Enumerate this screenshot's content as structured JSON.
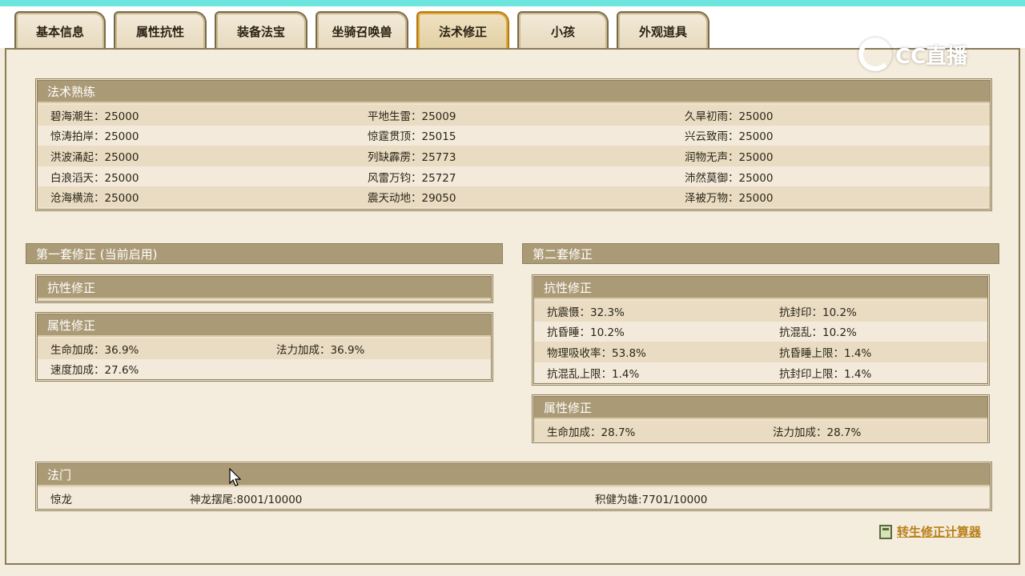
{
  "tabs": [
    {
      "label": "基本信息"
    },
    {
      "label": "属性抗性"
    },
    {
      "label": "装备法宝"
    },
    {
      "label": "坐骑召唤兽"
    },
    {
      "label": "法术修正"
    },
    {
      "label": "小孩"
    },
    {
      "label": "外观道具"
    }
  ],
  "active_tab": "法术修正",
  "watermark": "CC直播",
  "mastery": {
    "title": "法术熟练",
    "rows": [
      [
        "碧海潮生：25000",
        "平地生雷：25009",
        "久旱初雨：25000"
      ],
      [
        "惊涛拍岸：25000",
        "惊霆贯顶：25015",
        "兴云致雨：25000"
      ],
      [
        "洪波涌起：25000",
        "列缺霹雳：25773",
        "润物无声：25000"
      ],
      [
        "白浪滔天：25000",
        "风雷万钧：25727",
        "沛然莫御：25000"
      ],
      [
        "沧海横流：25000",
        "震天动地：29050",
        "泽被万物：25000"
      ]
    ]
  },
  "set1": {
    "title": "第一套修正 (当前启用)",
    "resist_title": "抗性修正",
    "attr_title": "属性修正",
    "attr_rows": [
      [
        "生命加成：36.9%",
        "法力加成：36.9%"
      ],
      [
        "速度加成：27.6%",
        ""
      ]
    ]
  },
  "set2": {
    "title": "第二套修正",
    "resist_title": "抗性修正",
    "resist_rows": [
      [
        "抗震慑：32.3%",
        "抗封印：10.2%"
      ],
      [
        "抗昏睡：10.2%",
        "抗混乱：10.2%"
      ],
      [
        "物理吸收率：53.8%",
        "抗昏睡上限：1.4%"
      ],
      [
        "抗混乱上限：1.4%",
        "抗封印上限：1.4%"
      ]
    ],
    "attr_title": "属性修正",
    "attr_rows": [
      [
        "生命加成：28.7%",
        "法力加成：28.7%"
      ]
    ]
  },
  "famen": {
    "title": "法门",
    "row": [
      "惊龙",
      "神龙摆尾:8001/10000",
      "积健为雄:7701/10000"
    ]
  },
  "calculator_link": "转生修正计算器"
}
